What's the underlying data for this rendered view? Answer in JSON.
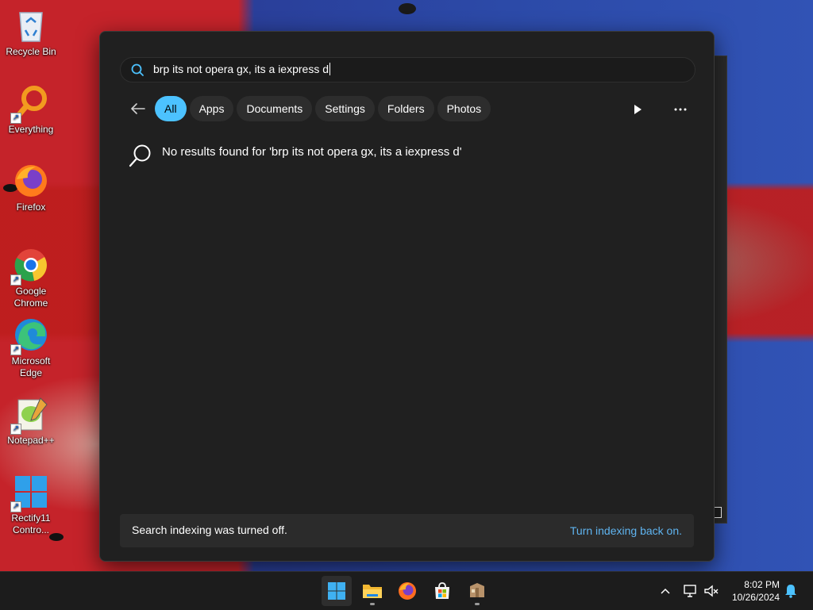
{
  "desktop": {
    "icons": [
      {
        "label": "Recycle Bin",
        "icon": "recycle-bin-icon"
      },
      {
        "label": "Everything",
        "icon": "everything-search-icon"
      },
      {
        "label": "Firefox",
        "icon": "firefox-icon"
      },
      {
        "label": "Google Chrome",
        "icon": "chrome-icon"
      },
      {
        "label": "Microsoft Edge",
        "icon": "edge-icon"
      },
      {
        "label": "Notepad++",
        "icon": "notepadpp-icon"
      },
      {
        "label": "Rectify11 Contro...",
        "icon": "rectify11-icon"
      }
    ]
  },
  "search": {
    "query": "brp its not opera gx, its a iexpress d",
    "filters": [
      {
        "label": "All",
        "active": true
      },
      {
        "label": "Apps",
        "active": false
      },
      {
        "label": "Documents",
        "active": false
      },
      {
        "label": "Settings",
        "active": false
      },
      {
        "label": "Folders",
        "active": false
      },
      {
        "label": "Photos",
        "active": false
      }
    ],
    "no_results": "No results found for 'brp its not opera gx, its a iexpress d'",
    "indexing_message": "Search indexing was turned off.",
    "indexing_link": "Turn indexing back on.",
    "accent_color": "#4cc2ff"
  },
  "taskbar": {
    "apps": [
      "start-icon",
      "file-explorer-icon",
      "firefox-icon",
      "microsoft-store-icon",
      "package-icon"
    ],
    "time": "8:02 PM",
    "date": "10/26/2024"
  }
}
